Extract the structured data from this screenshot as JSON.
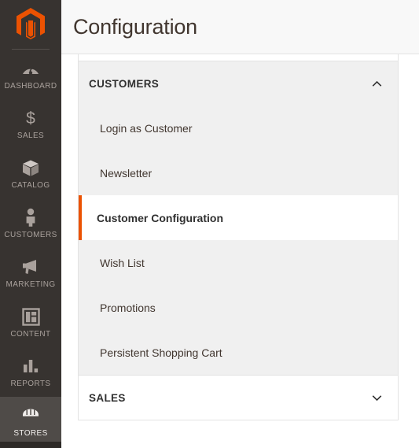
{
  "brand": {
    "logo_icon": "magento-logo-icon",
    "accent_color": "#eb5202"
  },
  "sidebar": {
    "items": [
      {
        "label": "DASHBOARD",
        "icon": "dashboard-icon",
        "active": false
      },
      {
        "label": "SALES",
        "icon": "dollar-icon",
        "active": false
      },
      {
        "label": "CATALOG",
        "icon": "box-icon",
        "active": false
      },
      {
        "label": "CUSTOMERS",
        "icon": "person-icon",
        "active": false
      },
      {
        "label": "MARKETING",
        "icon": "megaphone-icon",
        "active": false
      },
      {
        "label": "CONTENT",
        "icon": "layout-icon",
        "active": false
      },
      {
        "label": "REPORTS",
        "icon": "bar-chart-icon",
        "active": false
      },
      {
        "label": "STORES",
        "icon": "store-icon",
        "active": true
      }
    ]
  },
  "header": {
    "title": "Configuration"
  },
  "config_nav": {
    "sections": [
      {
        "title": "CUSTOMERS",
        "expanded": true,
        "chevron": "chevron-up-icon",
        "items": [
          {
            "label": "Login as Customer",
            "current": false
          },
          {
            "label": "Newsletter",
            "current": false
          },
          {
            "label": "Customer Configuration",
            "current": true
          },
          {
            "label": "Wish List",
            "current": false
          },
          {
            "label": "Promotions",
            "current": false
          },
          {
            "label": "Persistent Shopping Cart",
            "current": false
          }
        ]
      },
      {
        "title": "SALES",
        "expanded": false,
        "chevron": "chevron-down-icon",
        "items": []
      }
    ]
  }
}
